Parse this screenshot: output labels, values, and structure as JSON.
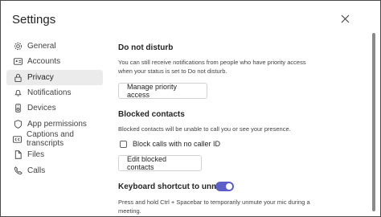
{
  "window": {
    "title": "Settings"
  },
  "nav": {
    "items": [
      {
        "label": "General",
        "icon": "gear-icon"
      },
      {
        "label": "Accounts",
        "icon": "id-card-icon"
      },
      {
        "label": "Privacy",
        "icon": "lock-icon",
        "active": true
      },
      {
        "label": "Notifications",
        "icon": "bell-icon"
      },
      {
        "label": "Devices",
        "icon": "speaker-icon"
      },
      {
        "label": "App permissions",
        "icon": "shield-icon"
      },
      {
        "label": "Captions and transcripts",
        "icon": "captions-icon"
      },
      {
        "label": "Files",
        "icon": "file-icon"
      },
      {
        "label": "Calls",
        "icon": "phone-icon"
      }
    ]
  },
  "do_not_disturb": {
    "title": "Do not disturb",
    "description": "You can still receive notifications from people who have priority access when your status is set to Do not disturb.",
    "button": "Manage priority access"
  },
  "blocked_contacts": {
    "title": "Blocked contacts",
    "description": "Blocked contacts will be unable to call you or see your presence.",
    "checkbox_label": "Block calls with no caller ID",
    "checkbox_checked": false,
    "button": "Edit blocked contacts"
  },
  "keyboard_shortcut": {
    "title": "Keyboard shortcut to unmute",
    "toggle_on": true,
    "description": "Press and hold Ctrl + Spacebar to temporarily unmute your mic during a meeting."
  },
  "colors": {
    "accent": "#5b5fc7",
    "active_nav_bg": "#ebebeb"
  }
}
